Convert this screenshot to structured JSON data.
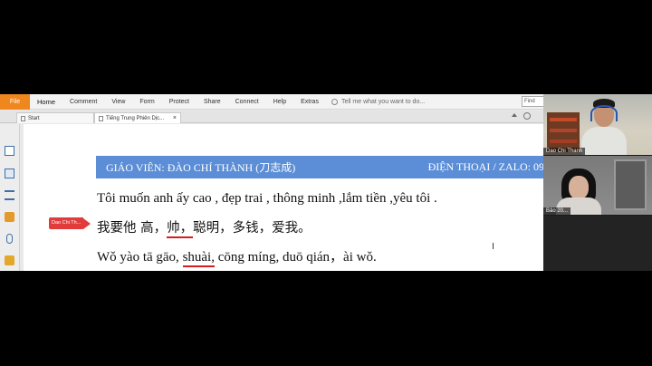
{
  "menubar": {
    "file": "File",
    "items": [
      "Home",
      "Comment",
      "View",
      "Form",
      "Protect",
      "Share",
      "Connect",
      "Help",
      "Extras"
    ],
    "tell_me": "Tell me what you want to do...",
    "find_placeholder": "Find"
  },
  "tabs": {
    "start": "Start",
    "doc": "Tiếng Trung Phiên Dịc...",
    "close": "×"
  },
  "document": {
    "header_left": "GIÁO VIÊN: ĐÀO CHÍ THÀNH (刀志成)",
    "header_right": "ĐIỆN THOẠI / ZALO: 09",
    "line_vi": "Tôi muốn anh ấy cao , đẹp trai , thông minh ,lắm tiền ,yêu tôi .",
    "line_zh_a": "我要他 高，",
    "line_zh_u": "帅，",
    "line_zh_b": "聪明，多钱，爱我。",
    "line_py_a": "Wǒ yào tā gāo, ",
    "line_py_u": "shuài,",
    "line_py_b": " cōng míng, duō qián，ài wǒ.",
    "name_tag": "Dao Chi Th..."
  },
  "video": {
    "cam1_label": "Dao Chi Thanh",
    "cam2_label": "Bảo 20..."
  },
  "colors": {
    "header_band": "#5b8ed6",
    "underline": "#d21f1f",
    "file_tab": "#f0861e",
    "name_tag": "#e23b3b"
  }
}
